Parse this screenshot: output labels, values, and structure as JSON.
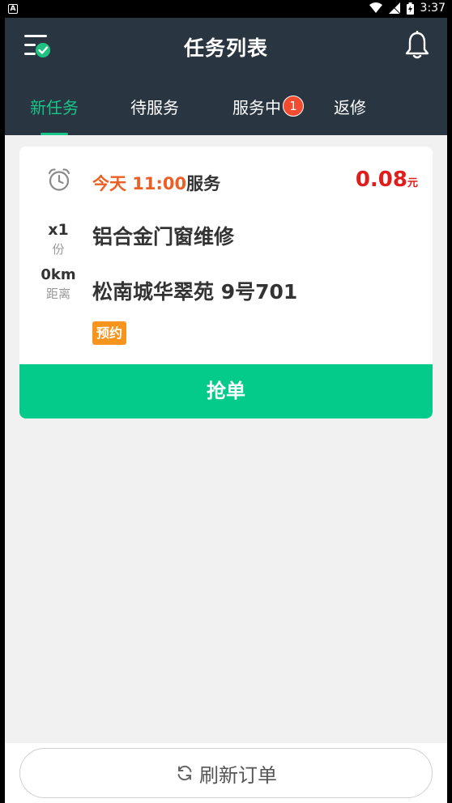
{
  "status_bar": {
    "notification": "A",
    "time": "3:37"
  },
  "header": {
    "title": "任务列表",
    "menu_icon": "menu-check-icon",
    "bell_icon": "bell-icon"
  },
  "tabs": [
    {
      "label": "新任务",
      "active": true
    },
    {
      "label": "待服务",
      "active": false
    },
    {
      "label": "服务中",
      "active": false,
      "badge": "1"
    },
    {
      "label": "返修",
      "active": false
    }
  ],
  "order": {
    "time_highlight": "今天 11:00",
    "time_suffix": "服务",
    "price": "0.08",
    "price_unit": "元",
    "quantity": "x1",
    "quantity_label": "份",
    "distance": "0km",
    "distance_label": "距离",
    "service_name": "铝合金门窗维修",
    "address": "松南城华翠苑 9号701",
    "tag": "预约",
    "grab_label": "抢单"
  },
  "footer": {
    "refresh_label": "刷新订单"
  },
  "colors": {
    "header_bg": "#2a3542",
    "accent_green": "#05cb8a",
    "time_orange": "#ec5f24",
    "price_red": "#e01c1c",
    "tag_orange": "#f7941d",
    "badge_red": "#f24b30"
  }
}
